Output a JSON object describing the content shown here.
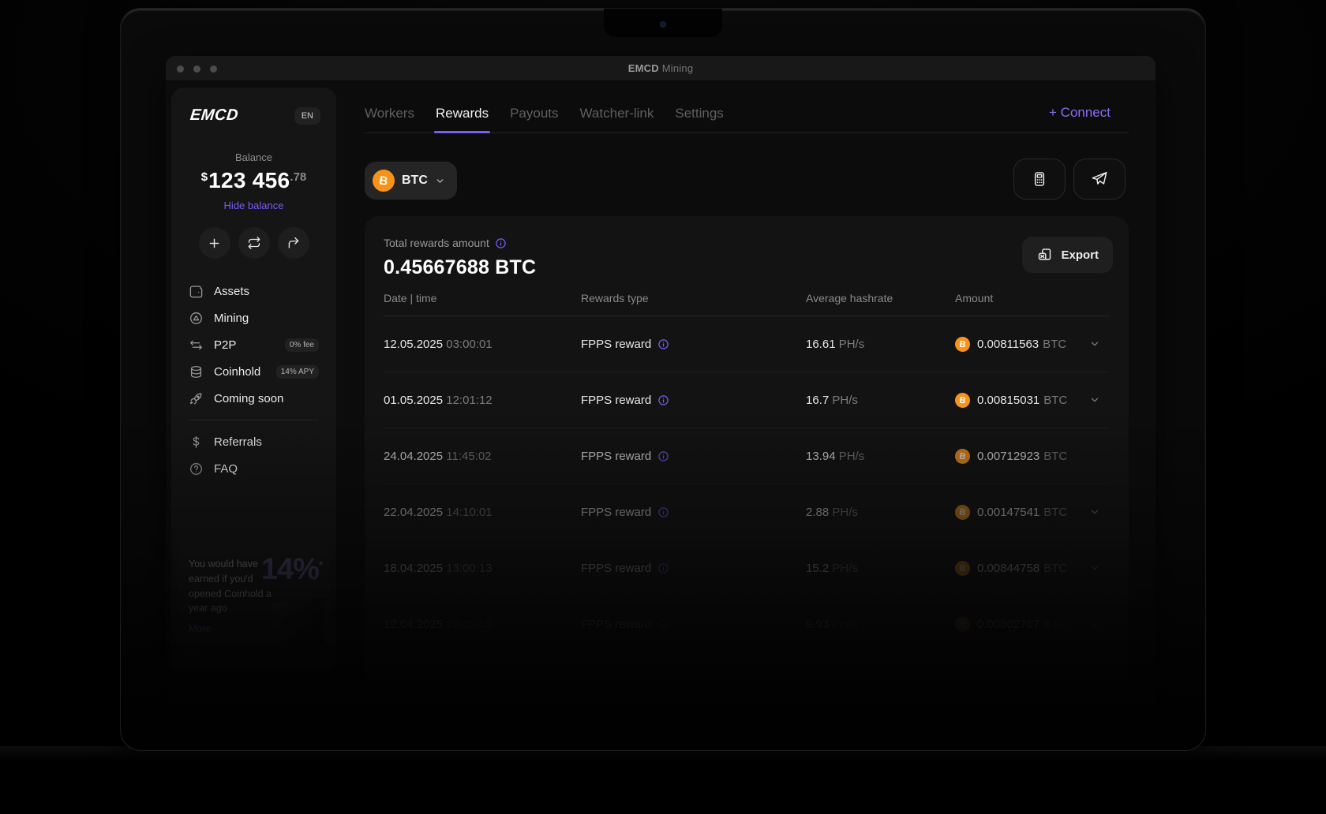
{
  "window": {
    "title_primary": "EMCD",
    "title_secondary": "Mining"
  },
  "sidebar": {
    "logo": "EMCD",
    "language": "EN",
    "balance": {
      "label": "Balance",
      "currency": "$",
      "amount": "123 456",
      "fraction": ".78",
      "hide_label": "Hide balance"
    },
    "nav": [
      {
        "label": "Assets"
      },
      {
        "label": "Mining"
      },
      {
        "label": "P2P",
        "badge": "0% fee"
      },
      {
        "label": "Coinhold",
        "badge": "14% APY"
      },
      {
        "label": "Coming soon"
      },
      {
        "label": "Referrals"
      },
      {
        "label": "FAQ"
      }
    ],
    "promo": {
      "text": "You would have earned if you'd opened Coinhold a year ago",
      "more_label": "More",
      "percent": "14%",
      "percent_note": "*"
    }
  },
  "tabs": [
    {
      "label": "Workers"
    },
    {
      "label": "Rewards"
    },
    {
      "label": "Payouts"
    },
    {
      "label": "Watcher-link"
    },
    {
      "label": "Settings"
    }
  ],
  "connect_label": "+ Connect",
  "toolbar": {
    "coin": "BTC",
    "coin_symbol": "B"
  },
  "rewards": {
    "total_label": "Total rewards amount",
    "total_value": "0.45667688 BTC",
    "export_label": "Export"
  },
  "table": {
    "headers": [
      "Date | time",
      "Rewards type",
      "Average hashrate",
      "Amount"
    ],
    "rows": [
      {
        "date": "12.05.2025",
        "time": "03:00:01",
        "type": "FPPS reward",
        "hashrate": "16.61",
        "hashrate_unit": "PH/s",
        "amount": "0.00811563",
        "amount_unit": "BTC"
      },
      {
        "date": "01.05.2025",
        "time": "12:01:12",
        "type": "FPPS reward",
        "hashrate": "16.7",
        "hashrate_unit": "PH/s",
        "amount": "0.00815031",
        "amount_unit": "BTC"
      },
      {
        "date": "24.04.2025",
        "time": "11:45:02",
        "type": "FPPS reward",
        "hashrate": "13.94",
        "hashrate_unit": "PH/s",
        "amount": "0.00712923",
        "amount_unit": "BTC"
      },
      {
        "date": "22.04.2025",
        "time": "14:10:01",
        "type": "FPPS reward",
        "hashrate": "2.88",
        "hashrate_unit": "PH/s",
        "amount": "0.00147541",
        "amount_unit": "BTC"
      },
      {
        "date": "18.04.2025",
        "time": "13:00:13",
        "type": "FPPS reward",
        "hashrate": "15.2",
        "hashrate_unit": "PH/s",
        "amount": "0.00844758",
        "amount_unit": "BTC"
      },
      {
        "date": "12.04.2025",
        "time": "23:22:05",
        "type": "FPPS reward",
        "hashrate": "9.93",
        "hashrate_unit": "PH/s",
        "amount": "0.00802767",
        "amount_unit": "BTC"
      }
    ]
  },
  "colors": {
    "accent": "#7b5bf5",
    "bitcoin": "#f7931a",
    "window_bg": "#0c0c0c",
    "card_bg": "#131313"
  }
}
